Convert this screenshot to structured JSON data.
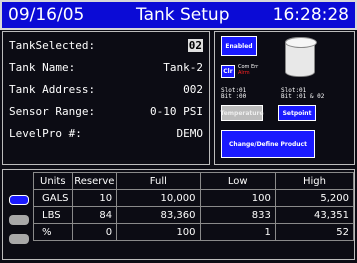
{
  "header": {
    "date": "09/16/05",
    "title": "Tank Setup",
    "time": "16:28:28"
  },
  "info": {
    "tank_selected_label": "TankSelected:",
    "tank_selected_value": "02",
    "tank_name_label": "Tank Name:",
    "tank_name_value": "Tank-2",
    "tank_address_label": "Tank Address:",
    "tank_address_value": "002",
    "sensor_range_label": "Sensor Range:",
    "sensor_range_value": "0-10 PSI",
    "levelpro_label": "LevelPro #:",
    "levelpro_value": "DEMO"
  },
  "panel": {
    "enabled": "Enabled",
    "clr": "Clr",
    "alarm_top": "Com Err",
    "alarm_bottom": "Alrm",
    "slot1_a": "Slot:01",
    "slot1_b": "Bit :00",
    "slot2_a": "Slot:01",
    "slot2_b": "Bit :01 & 02",
    "temperature": "Temperature",
    "setpoint": "Setpoint",
    "change": "Change/Define  Product"
  },
  "table": {
    "headers": [
      "Units",
      "Reserve",
      "Full",
      "Low",
      "High"
    ],
    "rows": [
      [
        "GALS",
        "10",
        "10,000",
        "100",
        "5,200"
      ],
      [
        "LBS",
        "84",
        "83,360",
        "833",
        "43,351"
      ],
      [
        "%",
        "0",
        "100",
        "1",
        "52"
      ]
    ]
  }
}
